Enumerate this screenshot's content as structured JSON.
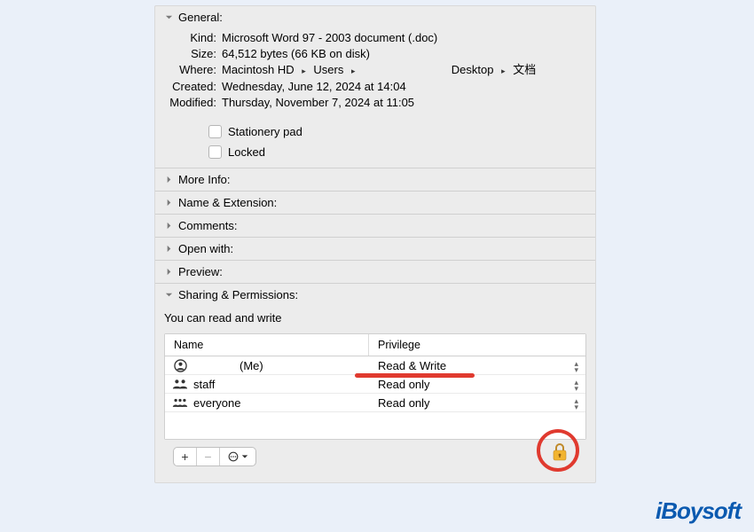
{
  "general": {
    "title": "General:",
    "kind_label": "Kind:",
    "kind_value": "Microsoft Word 97 - 2003 document (.doc)",
    "size_label": "Size:",
    "size_value": "64,512 bytes (66 KB on disk)",
    "where_label": "Where:",
    "where_segments": [
      "Macintosh HD",
      "Users",
      ""
    ],
    "where_segments2": [
      "Desktop",
      "文档"
    ],
    "created_label": "Created:",
    "created_value": "Wednesday, June 12, 2024 at 14:04",
    "modified_label": "Modified:",
    "modified_value": "Thursday, November 7, 2024 at 11:05",
    "stationery_label": "Stationery pad",
    "locked_label": "Locked"
  },
  "sections": {
    "more_info": "More Info:",
    "name_ext": "Name & Extension:",
    "comments": "Comments:",
    "open_with": "Open with:",
    "preview": "Preview:",
    "sharing": "Sharing & Permissions:"
  },
  "permissions": {
    "message": "You can read and write",
    "col_name": "Name",
    "col_priv": "Privilege",
    "rows": [
      {
        "name": "",
        "suffix": "(Me)",
        "priv": "Read & Write",
        "icon": "user"
      },
      {
        "name": "staff",
        "suffix": "",
        "priv": "Read only",
        "icon": "group"
      },
      {
        "name": "everyone",
        "suffix": "",
        "priv": "Read only",
        "icon": "group"
      }
    ]
  },
  "footer": {
    "add": "+",
    "remove": "−",
    "more": "⊙"
  },
  "watermark": "iBoysoft"
}
